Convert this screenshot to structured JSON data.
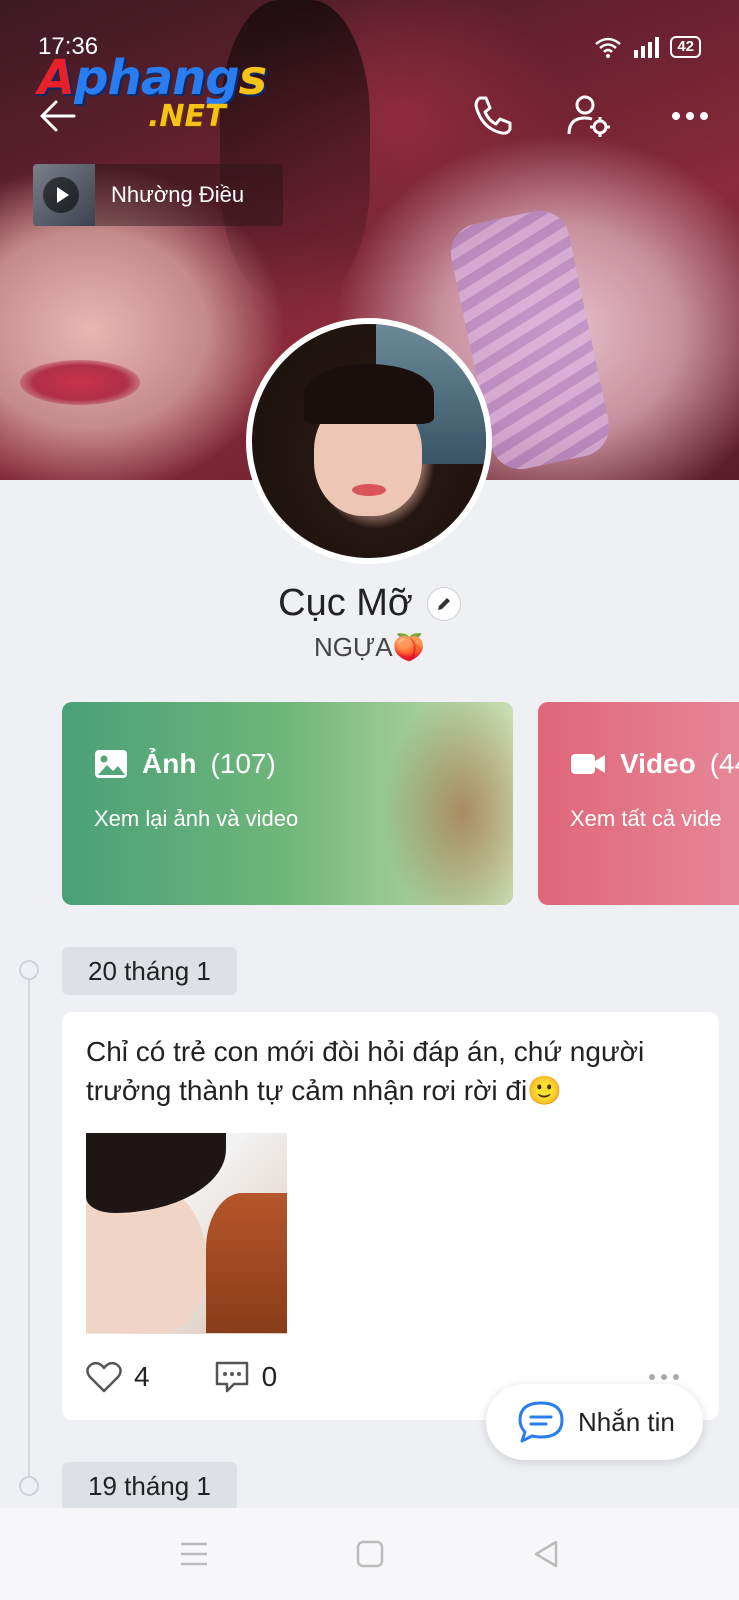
{
  "status_bar": {
    "time": "17:36",
    "battery": "42"
  },
  "watermark": {
    "line1_red": "A",
    "line1_blue": "phang",
    "line1_yellow": "s",
    "line2": ".NET"
  },
  "music": {
    "title": "Nhường Điều"
  },
  "profile": {
    "name": "Cục Mỡ",
    "bio": "NGỰA🍑"
  },
  "cards": [
    {
      "title": "Ảnh",
      "count": "(107)",
      "subtitle": "Xem lại ảnh và video",
      "color": "#52a67a"
    },
    {
      "title": "Video",
      "count": "(44",
      "subtitle": "Xem tất cả vide",
      "color": "#e0657a"
    }
  ],
  "timeline": [
    {
      "date": "20 tháng 1",
      "text": "Chỉ có trẻ con mới đòi hỏi đáp án, chứ người trưởng thành tự cảm nhận rơi rời đi🙂",
      "likes": "4",
      "comments": "0"
    },
    {
      "date": "19 tháng 1"
    }
  ],
  "fab": {
    "label": "Nhắn tin",
    "color": "#2a7df0"
  },
  "icons": [
    "back-arrow-icon",
    "phone-icon",
    "user-settings-icon",
    "more-icon",
    "image-icon",
    "video-camera-icon",
    "heart-icon",
    "comment-icon",
    "chat-icon",
    "menu-icon",
    "home-icon",
    "back-triangle-icon"
  ]
}
